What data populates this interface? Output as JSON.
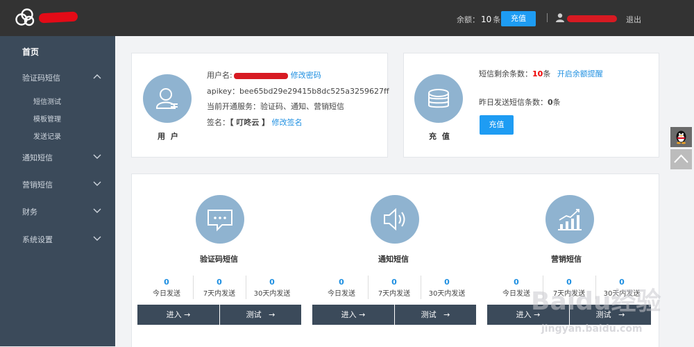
{
  "header": {
    "balance_label": "余额：",
    "balance_value": "10",
    "balance_unit": "条",
    "recharge_label": "充值",
    "logout_label": "退出"
  },
  "sidebar": {
    "home": "首页",
    "groups": [
      {
        "label": "验证码短信",
        "expanded": true,
        "children": [
          "短信测试",
          "模板管理",
          "发送记录"
        ]
      },
      {
        "label": "通知短信",
        "expanded": false
      },
      {
        "label": "营销短信",
        "expanded": false
      },
      {
        "label": "财务",
        "expanded": false
      },
      {
        "label": "系统设置",
        "expanded": false
      }
    ]
  },
  "user_card": {
    "caption": "用 户",
    "username_label": "用户名:",
    "change_password": "修改密码",
    "apikey_label": "apikey：",
    "apikey_value": "bee65bd29e29415b8dc525a3259627ff",
    "services_label": "当前开通服务：",
    "services_value": "验证码、通知、营销短信",
    "sign_label": "签名：",
    "sign_value": "【 叮咚云 】",
    "change_sign": "修改签名"
  },
  "recharge_card": {
    "caption": "充 值",
    "remain_label": "短信剩余条数：",
    "remain_value": "10",
    "remain_unit": "条",
    "alert_link": "开启余额提醒",
    "yesterday_label": "昨日发送短信条数：",
    "yesterday_value": "0",
    "yesterday_unit": "条",
    "button": "充值"
  },
  "services": [
    {
      "title": "验证码短信",
      "icon": "message-dots-icon",
      "stats": [
        {
          "value": "0",
          "label": "今日发送"
        },
        {
          "value": "0",
          "label": "7天内发送"
        },
        {
          "value": "0",
          "label": "30天内发送"
        }
      ],
      "enter": "进入",
      "test": "测试"
    },
    {
      "title": "通知短信",
      "icon": "speaker-icon",
      "stats": [
        {
          "value": "0",
          "label": "今日发送"
        },
        {
          "value": "0",
          "label": "7天内发送"
        },
        {
          "value": "0",
          "label": "30天内发送"
        }
      ],
      "enter": "进入",
      "test": "测试"
    },
    {
      "title": "营销短信",
      "icon": "trend-chart-icon",
      "stats": [
        {
          "value": "0",
          "label": "今日发送"
        },
        {
          "value": "0",
          "label": "7天内发送"
        },
        {
          "value": "0",
          "label": "30天内发送"
        }
      ],
      "enter": "进入",
      "test": "测试"
    }
  ],
  "arrow_glyph": "→",
  "watermark": {
    "brand": "Baidu经验",
    "url": "jingyan.baidu.com"
  },
  "colors": {
    "topbar": "#333333",
    "sidebar": "#3b4a5a",
    "accent": "#1e9cf3",
    "icon_circle": "#8fb3d0"
  }
}
